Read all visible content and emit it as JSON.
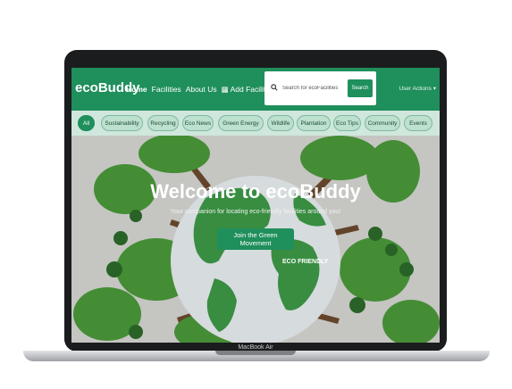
{
  "navbar": {
    "brand": "ecoBuddy",
    "links": [
      {
        "label": "Home",
        "active": true
      },
      {
        "label": "Facilities",
        "active": false
      },
      {
        "label": "About Us",
        "active": false
      },
      {
        "label": "Add Facility",
        "icon": "building-icon",
        "active": false
      }
    ],
    "search": {
      "placeholder": "Search for ecoFacilities",
      "value": "",
      "button_label": "Search"
    },
    "user_menu": "User Actions ▾"
  },
  "categories": [
    "All",
    "Sustainability",
    "Recycling",
    "Eco News",
    "Green Energy",
    "Wildlife",
    "Plantation",
    "Eco Tips",
    "Community",
    "Events"
  ],
  "active_category": "All",
  "hero": {
    "title": "Welcome to ecoBuddy",
    "subtitle": "Your companion for locating eco-friendly facilities around you!",
    "cta": "Join the Green Movement",
    "badge": "ECO FRIENDLY"
  },
  "device_label": "MacBook Air",
  "colors": {
    "primary": "#1f8f5c",
    "chip_bg": "#bde0cf",
    "chip_border": "#7fb89f"
  }
}
